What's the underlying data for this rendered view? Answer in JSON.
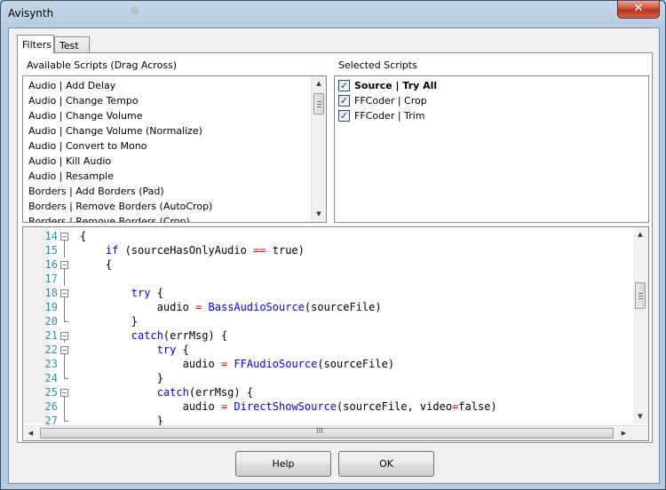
{
  "window": {
    "title": "Avisynth",
    "close_glyph": "✕"
  },
  "tabs": [
    {
      "label": "Filters",
      "selected": true
    },
    {
      "label": "Test",
      "selected": false
    }
  ],
  "available": {
    "label": "Available Scripts (Drag Across)",
    "items": [
      "Audio | Add Delay",
      "Audio | Change Tempo",
      "Audio | Change Volume",
      "Audio | Change Volume (Normalize)",
      "Audio | Convert to Mono",
      "Audio | Kill Audio",
      "Audio | Resample",
      "Borders | Add Borders (Pad)",
      "Borders | Remove Borders (AutoCrop)",
      "Borders | Remove Borders (Crop)"
    ]
  },
  "selected": {
    "label": "Selected Scripts",
    "items": [
      {
        "label": "Source | Try All",
        "checked": true,
        "bold": true
      },
      {
        "label": "FFCoder | Crop",
        "checked": true,
        "bold": false
      },
      {
        "label": "FFCoder | Trim",
        "checked": true,
        "bold": false
      }
    ]
  },
  "editor": {
    "lines": [
      {
        "num": "14",
        "fold": "box",
        "html": "{"
      },
      {
        "num": "15",
        "fold": "line",
        "html": "    <span class=\"kw\">if</span> (sourceHasOnlyAudio <span class=\"op\">==</span> true)"
      },
      {
        "num": "16",
        "fold": "box",
        "html": "    {"
      },
      {
        "num": "17",
        "fold": "line",
        "html": ""
      },
      {
        "num": "18",
        "fold": "box",
        "html": "        <span class=\"kw\">try</span> {"
      },
      {
        "num": "19",
        "fold": "line",
        "html": "            audio <span class=\"op\">=</span> <span class=\"fn\">BassAudioSource</span>(sourceFile)"
      },
      {
        "num": "20",
        "fold": "end",
        "html": "        }"
      },
      {
        "num": "21",
        "fold": "box",
        "html": "        <span class=\"kw\">catch</span>(errMsg) {"
      },
      {
        "num": "22",
        "fold": "box",
        "html": "            <span class=\"kw\">try</span> {"
      },
      {
        "num": "23",
        "fold": "line",
        "html": "                audio <span class=\"op\">=</span> <span class=\"fn\">FFAudioSource</span>(sourceFile)"
      },
      {
        "num": "24",
        "fold": "end",
        "html": "            }"
      },
      {
        "num": "25",
        "fold": "box",
        "html": "            <span class=\"kw\">catch</span>(errMsg) {"
      },
      {
        "num": "26",
        "fold": "line",
        "html": "                audio <span class=\"op\">=</span> <span class=\"fn\">DirectShowSource</span>(sourceFile, video<span class=\"op\">=</span>false)"
      },
      {
        "num": "27",
        "fold": "end",
        "html": "            }"
      }
    ],
    "hscroll_grip": "III"
  },
  "buttons": {
    "help": "Help",
    "ok": "OK"
  },
  "icons": {
    "fold_box": "minus-box-icon",
    "checkbox": "check-icon"
  },
  "colors": {
    "line_number": "#2b91af",
    "keyword": "#0000ff",
    "operator": "#e00000",
    "close_button": "#c74a35"
  }
}
